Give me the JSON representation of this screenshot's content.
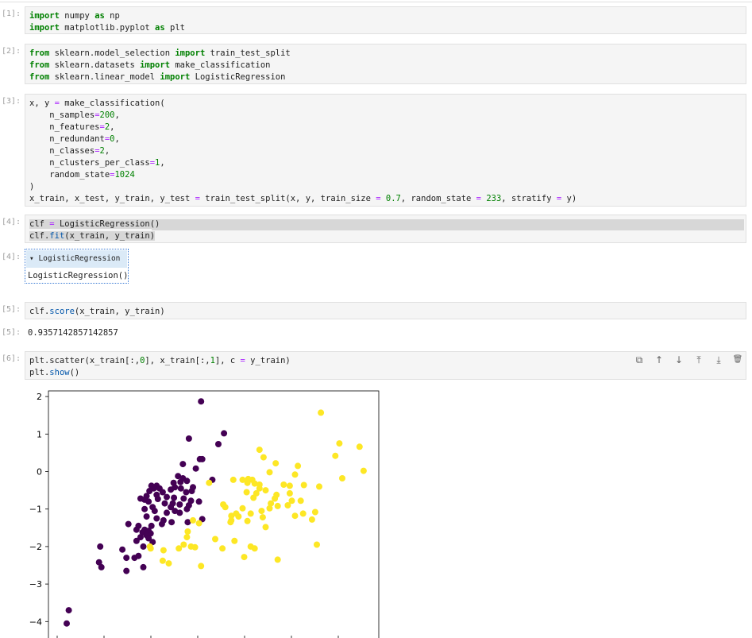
{
  "cells": [
    {
      "prompt": "[1]:",
      "lines": [
        "import numpy as np",
        "import matplotlib.pyplot as plt"
      ]
    },
    {
      "prompt": "[2]:",
      "lines": [
        "from sklearn.model_selection import train_test_split",
        "from sklearn.datasets import make_classification",
        "from sklearn.linear_model import LogisticRegression"
      ]
    },
    {
      "prompt": "[3]:",
      "lines": [
        "x, y = make_classification(",
        "    n_samples=200,",
        "    n_features=2,",
        "    n_redundant=0,",
        "    n_classes=2,",
        "    n_clusters_per_class=1,",
        "    random_state=1024",
        ")",
        "x_train, x_test, y_train, y_test = train_test_split(x, y, train_size = 0.7, random_state = 233, stratify = y)"
      ]
    },
    {
      "prompt": "[4]:",
      "lines": [
        "clf = LogisticRegression()",
        "clf.fit(x_train, y_train)"
      ]
    },
    {
      "prompt": "[5]:",
      "lines": [
        "clf.score(x_train, y_train)"
      ]
    },
    {
      "prompt": "[6]:",
      "lines": [
        "plt.scatter(x_train[:,0], x_train[:,1], c = y_train)",
        "plt.show()"
      ]
    }
  ],
  "outputs": {
    "out4_prompt": "[4]:",
    "estimator_header": "▾ LogisticRegression",
    "estimator_body": "LogisticRegression()",
    "out5_prompt": "[5]:",
    "out5_value": "0.9357142857142857"
  },
  "toolbar": {
    "copy_icon": "⧉",
    "up_icon": "↑",
    "down_icon": "↓",
    "insert_above_icon": "⤒",
    "insert_below_icon": "⤓",
    "delete_icon": "🗑"
  },
  "colors": {
    "class0": "#440154",
    "class1": "#fde725"
  },
  "chart_data": {
    "type": "scatter",
    "title": "",
    "xlabel": "",
    "ylabel": "",
    "ylim": [
      -4.3,
      2.15
    ],
    "xlim": [
      -2.3,
      3.0
    ],
    "yticks": [
      "2",
      "1",
      "0",
      "−1",
      "−2",
      "−3",
      "−4"
    ],
    "series": [
      {
        "color": "#440154",
        "points": [
          [
            -0.25,
            1.87
          ],
          [
            -0.55,
            0.88
          ],
          [
            0.32,
            1.02
          ],
          [
            0.18,
            0.73
          ],
          [
            -0.28,
            0.33
          ],
          [
            -0.22,
            0.33
          ],
          [
            -0.7,
            0.2
          ],
          [
            -0.38,
            0.08
          ],
          [
            -0.82,
            -0.12
          ],
          [
            -0.7,
            -0.18
          ],
          [
            -0.6,
            -0.25
          ],
          [
            -0.76,
            -0.28
          ],
          [
            -0.93,
            -0.3
          ],
          [
            0.03,
            -0.22
          ],
          [
            -1.35,
            -0.38
          ],
          [
            -1.48,
            -0.38
          ],
          [
            -1.42,
            -0.45
          ],
          [
            -1.28,
            -0.45
          ],
          [
            -1.53,
            -0.52
          ],
          [
            -1.2,
            -0.55
          ],
          [
            -1.0,
            -0.48
          ],
          [
            -0.9,
            -0.42
          ],
          [
            -0.75,
            -0.45
          ],
          [
            -0.62,
            -0.55
          ],
          [
            -0.48,
            -0.52
          ],
          [
            -0.45,
            -0.42
          ],
          [
            -1.35,
            -0.62
          ],
          [
            -1.6,
            -0.65
          ],
          [
            -1.75,
            -0.72
          ],
          [
            -1.65,
            -0.75
          ],
          [
            -1.55,
            -0.8
          ],
          [
            -1.32,
            -0.73
          ],
          [
            -1.1,
            -0.68
          ],
          [
            -0.92,
            -0.7
          ],
          [
            -0.68,
            -0.72
          ],
          [
            -0.5,
            -0.78
          ],
          [
            -0.3,
            -0.8
          ],
          [
            -1.15,
            -0.85
          ],
          [
            -0.95,
            -0.85
          ],
          [
            -0.78,
            -0.88
          ],
          [
            -0.55,
            -0.9
          ],
          [
            -1.45,
            -0.95
          ],
          [
            -1.65,
            -1.0
          ],
          [
            -1.0,
            -0.95
          ],
          [
            -0.6,
            -1.0
          ],
          [
            -0.9,
            -1.05
          ],
          [
            -1.1,
            -1.1
          ],
          [
            -1.4,
            -1.05
          ],
          [
            -0.78,
            -1.1
          ],
          [
            -1.6,
            -1.2
          ],
          [
            -1.35,
            -1.25
          ],
          [
            -1.18,
            -1.3
          ],
          [
            -0.98,
            -1.35
          ],
          [
            -1.22,
            -1.4
          ],
          [
            -1.48,
            -1.45
          ],
          [
            -0.58,
            -1.35
          ],
          [
            -0.22,
            -1.27
          ],
          [
            -2.05,
            -1.4
          ],
          [
            -1.8,
            -1.45
          ],
          [
            -1.85,
            -1.55
          ],
          [
            -1.65,
            -1.55
          ],
          [
            -1.55,
            -1.58
          ],
          [
            -1.7,
            -1.62
          ],
          [
            -1.5,
            -1.65
          ],
          [
            -1.6,
            -1.7
          ],
          [
            -1.75,
            -1.75
          ],
          [
            -1.55,
            -1.78
          ],
          [
            -1.45,
            -1.88
          ],
          [
            -1.85,
            -1.85
          ],
          [
            -2.75,
            -2.0
          ],
          [
            -2.2,
            -2.08
          ],
          [
            -1.68,
            -2.0
          ],
          [
            -1.8,
            -2.25
          ],
          [
            -1.9,
            -2.3
          ],
          [
            -2.1,
            -2.3
          ],
          [
            -2.78,
            -2.42
          ],
          [
            -2.72,
            -2.55
          ],
          [
            -2.1,
            -2.65
          ],
          [
            -1.68,
            -2.55
          ],
          [
            -3.53,
            -3.7
          ],
          [
            -3.58,
            -4.05
          ]
        ]
      },
      {
        "color": "#fde725",
        "points": [
          [
            2.72,
            1.57
          ],
          [
            1.2,
            0.58
          ],
          [
            1.3,
            0.38
          ],
          [
            3.18,
            0.75
          ],
          [
            3.68,
            0.66
          ],
          [
            3.08,
            0.42
          ],
          [
            1.6,
            0.22
          ],
          [
            2.15,
            0.15
          ],
          [
            1.45,
            -0.02
          ],
          [
            2.08,
            -0.08
          ],
          [
            3.78,
            0.02
          ],
          [
            3.25,
            -0.18
          ],
          [
            0.55,
            -0.22
          ],
          [
            0.78,
            -0.22
          ],
          [
            0.92,
            -0.2
          ],
          [
            1.02,
            -0.22
          ],
          [
            0.9,
            -0.3
          ],
          [
            1.08,
            -0.32
          ],
          [
            1.2,
            -0.35
          ],
          [
            1.8,
            -0.35
          ],
          [
            1.95,
            -0.38
          ],
          [
            2.3,
            -0.36
          ],
          [
            2.68,
            -0.4
          ],
          [
            -0.05,
            -0.3
          ],
          [
            1.2,
            -0.45
          ],
          [
            1.35,
            -0.5
          ],
          [
            1.95,
            -0.58
          ],
          [
            1.62,
            -0.62
          ],
          [
            1.12,
            -0.58
          ],
          [
            0.88,
            -0.55
          ],
          [
            1.58,
            -0.72
          ],
          [
            1.05,
            -0.7
          ],
          [
            2.0,
            -0.78
          ],
          [
            2.22,
            -0.78
          ],
          [
            1.48,
            -0.85
          ],
          [
            1.65,
            -0.92
          ],
          [
            1.9,
            -0.9
          ],
          [
            1.45,
            -0.98
          ],
          [
            0.3,
            -0.88
          ],
          [
            0.35,
            -0.95
          ],
          [
            0.78,
            -0.98
          ],
          [
            1.25,
            -1.05
          ],
          [
            2.58,
            -1.08
          ],
          [
            0.5,
            -1.18
          ],
          [
            0.62,
            -1.12
          ],
          [
            0.68,
            -1.2
          ],
          [
            1.28,
            -1.22
          ],
          [
            0.5,
            -1.3
          ],
          [
            0.9,
            -1.32
          ],
          [
            0.98,
            -1.12
          ],
          [
            2.28,
            -1.12
          ],
          [
            2.08,
            -1.18
          ],
          [
            0.48,
            -1.35
          ],
          [
            -0.45,
            -1.3
          ],
          [
            -0.3,
            -1.38
          ],
          [
            1.35,
            -1.48
          ],
          [
            2.5,
            -1.28
          ],
          [
            -0.58,
            -1.6
          ],
          [
            -0.6,
            -1.75
          ],
          [
            0.1,
            -1.8
          ],
          [
            0.58,
            -1.85
          ],
          [
            -0.68,
            -1.95
          ],
          [
            -0.8,
            -2.05
          ],
          [
            -0.5,
            -2.0
          ],
          [
            -0.4,
            -2.02
          ],
          [
            -1.52,
            -2.0
          ],
          [
            0.98,
            -2.0
          ],
          [
            1.08,
            -2.05
          ],
          [
            2.62,
            -1.95
          ],
          [
            -1.18,
            -2.1
          ],
          [
            -1.5,
            -2.05
          ],
          [
            0.28,
            -2.05
          ],
          [
            0.82,
            -2.28
          ],
          [
            1.65,
            -2.35
          ],
          [
            -1.2,
            -2.38
          ],
          [
            -1.05,
            -2.45
          ],
          [
            -0.25,
            -2.52
          ]
        ]
      }
    ]
  }
}
